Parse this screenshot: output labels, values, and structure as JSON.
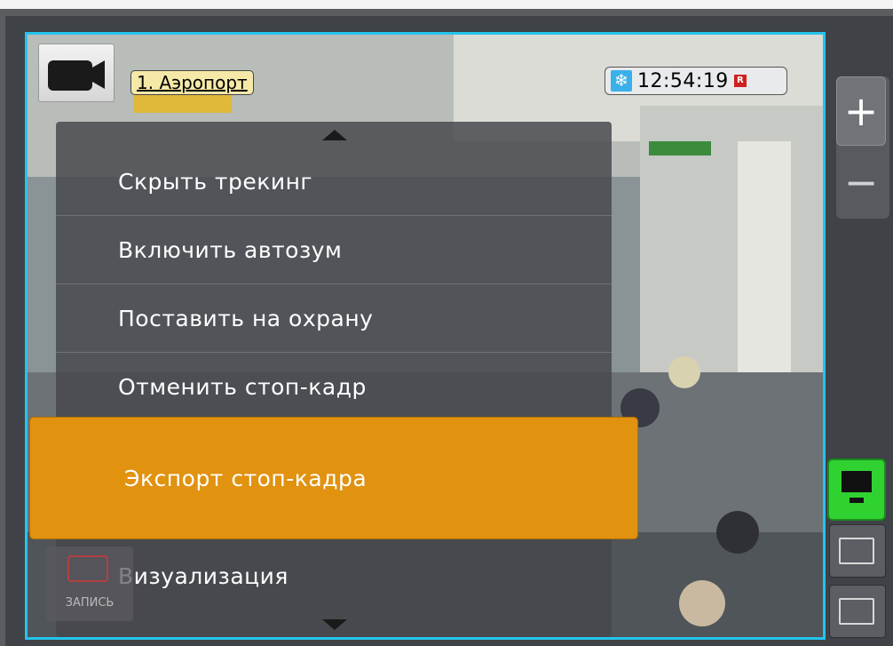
{
  "camera": {
    "label": "1. Аэропорт",
    "time": "12:54:19",
    "rec_mark": "R"
  },
  "menu": {
    "items": [
      {
        "label": "Скрыть трекинг"
      },
      {
        "label": "Включить автозум"
      },
      {
        "label": "Поставить на охрану"
      },
      {
        "label": "Отменить стоп-кадр"
      },
      {
        "label": "Экспорт стоп-кадра"
      },
      {
        "label": "Визуализация"
      }
    ]
  },
  "record": {
    "caption": "ЗАПИСЬ"
  },
  "controls": {
    "zoom_in": "+",
    "zoom_out": "−"
  },
  "colors": {
    "tile_border": "#25c4ee",
    "highlight": "#e1920f",
    "live_button": "#30d232"
  }
}
